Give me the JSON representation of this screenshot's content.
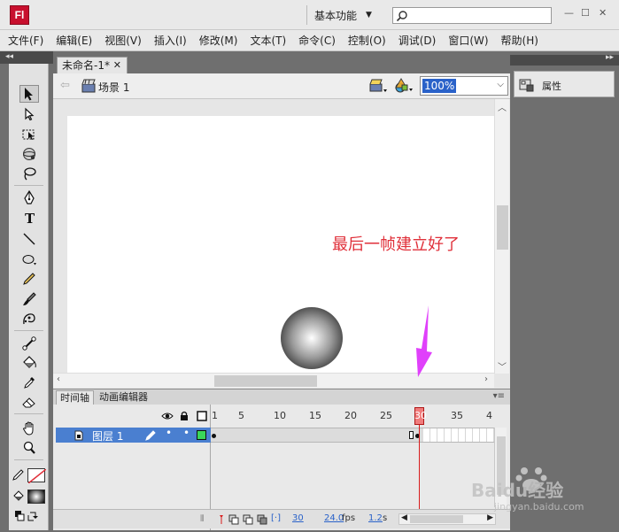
{
  "app": {
    "logo_text": "Fl",
    "workspace_label": "基本功能",
    "search_placeholder": ""
  },
  "menu": [
    "文件(F)",
    "编辑(E)",
    "视图(V)",
    "插入(I)",
    "修改(M)",
    "文本(T)",
    "命令(C)",
    "控制(O)",
    "调试(D)",
    "窗口(W)",
    "帮助(H)"
  ],
  "document": {
    "tab_label": "未命名-1*",
    "scene_label": "场景 1",
    "zoom_value": "100%"
  },
  "timeline": {
    "tabs": [
      "时间轴",
      "动画编辑器"
    ],
    "layer_name": "图层 1",
    "ruler": [
      "1",
      "5",
      "10",
      "15",
      "20",
      "25",
      "30",
      "35",
      "4"
    ],
    "current_frame": "30",
    "fps": "24.0",
    "fps_unit": "fps",
    "elapsed": "1.2",
    "elapsed_unit": "s"
  },
  "properties": {
    "tab_label": "属性"
  },
  "annotation": {
    "text": "最后一帧建立好了",
    "color": "#e0303a"
  },
  "watermark": {
    "brand": "Baidu经验",
    "url": "jingyan.baidu.com"
  },
  "colors": {
    "fl_brand": "#c8102e",
    "selection": "#4a7fd0",
    "playhead": "#d81b1b",
    "arrow": "#e040fb"
  }
}
